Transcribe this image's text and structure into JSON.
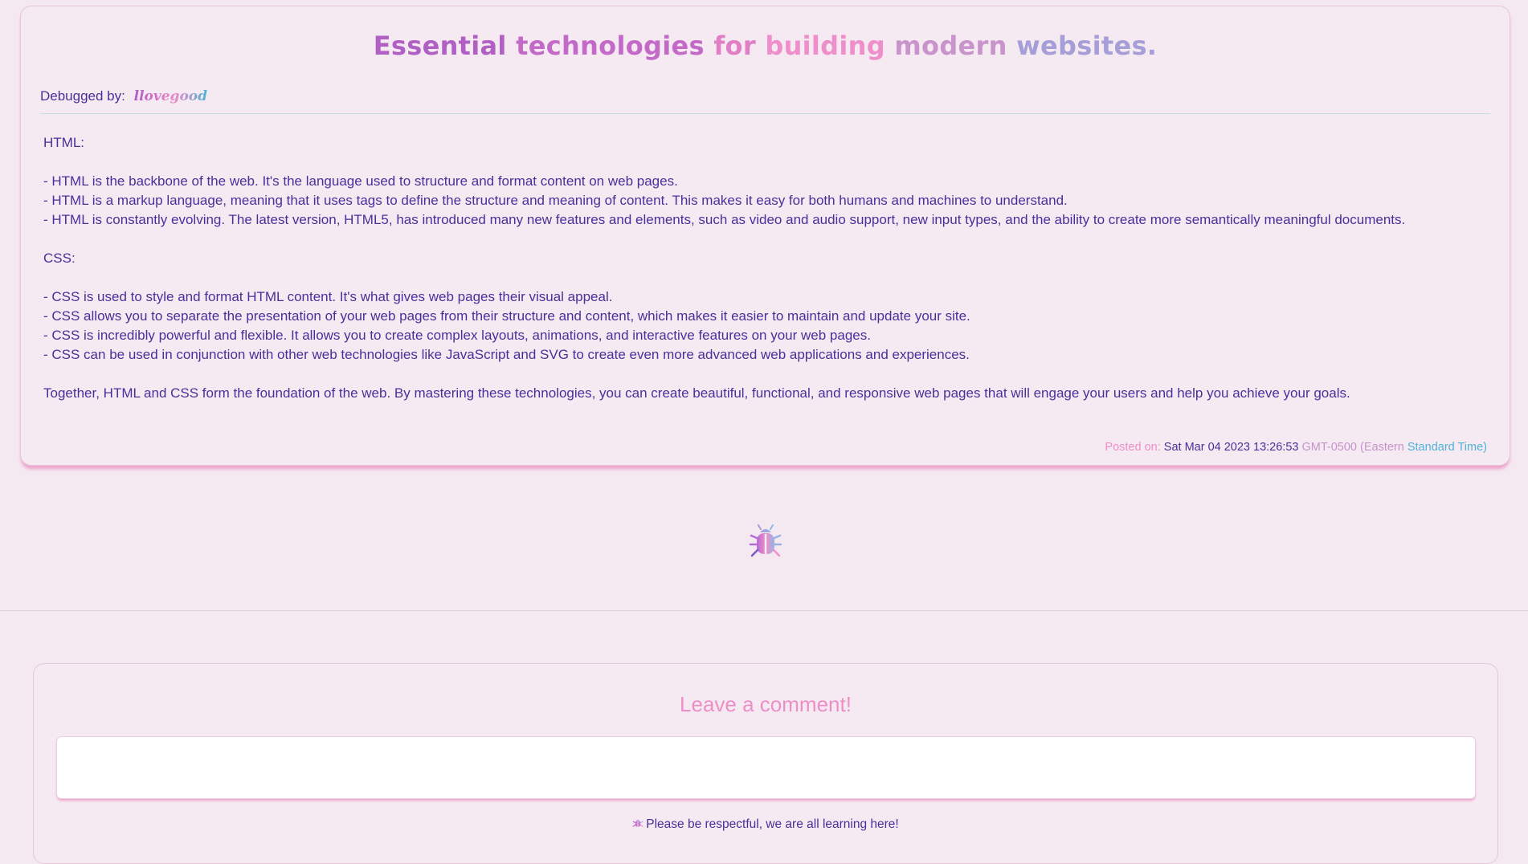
{
  "post": {
    "title_words": [
      "Essential",
      "technologies",
      "for",
      "building",
      "modern",
      "websites."
    ],
    "debugged_by_label": "Debugged by:",
    "debugged_by_user": "llovegood",
    "body": [
      "HTML:",
      "",
      "- HTML is the backbone of the web. It's the language used to structure and format content on web pages.",
      "- HTML is a markup language, meaning that it uses tags to define the structure and meaning of content. This makes it easy for both humans and machines to understand.",
      "- HTML is constantly evolving. The latest version, HTML5, has introduced many new features and elements, such as video and audio support, new input types, and the ability to create more semantically meaningful documents.",
      "",
      "CSS:",
      "",
      "- CSS is used to style and format HTML content. It's what gives web pages their visual appeal.",
      "- CSS allows you to separate the presentation of your web pages from their structure and content, which makes it easier to maintain and update your site.",
      "- CSS is incredibly powerful and flexible. It allows you to create complex layouts, animations, and interactive features on your web pages.",
      "- CSS can be used in conjunction with other web technologies like JavaScript and SVG to create even more advanced web applications and experiences.",
      "",
      "Together, HTML and CSS form the foundation of the web. By mastering these technologies, you can create beautiful, functional, and responsive web pages that will engage your users and help you achieve your goals."
    ],
    "posted_on_label": "Posted on:",
    "posted_on_date": "Sat Mar 04 2023 13:26:53",
    "posted_on_tz": "GMT-0500 (Eastern",
    "posted_on_tz_name": "Standard Time)"
  },
  "divider_icon": "bug-icon",
  "comments": {
    "title": "Leave a comment!",
    "input_value": "",
    "note_icon": "bug-icon",
    "note": "Please be respectful, we are all learning here!"
  },
  "colors": {
    "background": "#f5e9f1",
    "text": "#4a2f9a",
    "pink": "#ee8ec8",
    "purple": "#b060c4",
    "lavender": "#a69ed6",
    "blue": "#4fb3d8"
  }
}
